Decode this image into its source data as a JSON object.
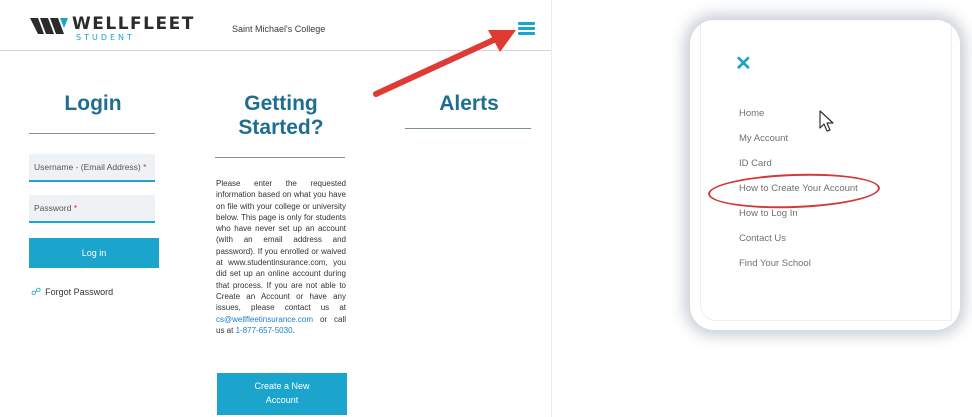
{
  "site": {
    "brand": {
      "name": "WELLFLEET",
      "sub": "STUDENT"
    },
    "college": "Saint Michael's College",
    "login": {
      "title": "Login",
      "username_placeholder": "Username - (Email Address)",
      "password_placeholder": "Password",
      "required_mark": "*",
      "login_button": "Log in",
      "forgot_password": "Forgot Password"
    },
    "getting_started": {
      "title_line1": "Getting",
      "title_line2": "Started?",
      "text_part1": "Please enter the requested information based on what you have on file with your college or university below. This page is only for students who have never set up an account (with an email address and password). If you enrolled or waived at www.studentinsurance.com, you did set up an online account during that process. If you are not able to Create an Account or have any issues, please contact us at",
      "email": "cs@wellfleetinsurance.com",
      "text_part2": "or call us at",
      "phone": "1-877-657-5030",
      "text_end": ".",
      "create_button_line1": "Create a New",
      "create_button_line2": "Account"
    },
    "alerts": {
      "title": "Alerts"
    }
  },
  "menu": {
    "items": [
      {
        "label": "Home"
      },
      {
        "label": "My Account"
      },
      {
        "label": "ID Card"
      },
      {
        "label": "How to Create Your Account"
      },
      {
        "label": "How to Log In"
      },
      {
        "label": "Contact Us"
      },
      {
        "label": "Find Your School"
      }
    ]
  },
  "colors": {
    "accent": "#1ba4cc",
    "heading": "#1f6e92",
    "annotation": "#d23a3a"
  },
  "icons": {
    "hamburger": "hamburger-menu-icon",
    "close": "close-icon",
    "link": "link-icon",
    "pointer": "mouse-pointer-icon",
    "arrow": "red-arrow-annotation"
  }
}
